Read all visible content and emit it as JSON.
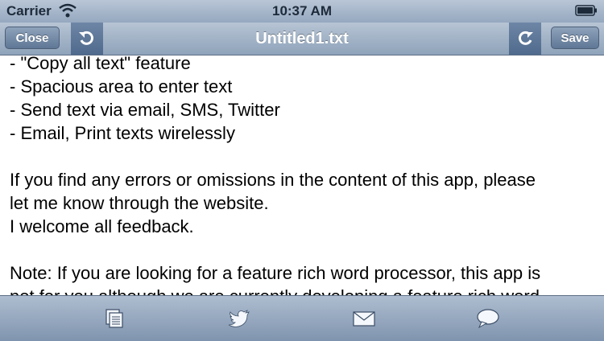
{
  "status": {
    "carrier": "Carrier",
    "time": "10:37 AM",
    "icons": [
      "wifi-icon",
      "battery-icon"
    ]
  },
  "nav": {
    "close_label": "Close",
    "title": "Untitled1.txt",
    "save_label": "Save",
    "icons": [
      "undo-icon",
      "redo-icon"
    ]
  },
  "editor": {
    "lines": [
      "- \"Copy all text\" feature",
      "- Spacious area to enter text",
      "- Send text via email, SMS, Twitter",
      "- Email, Print texts wirelessly",
      "",
      "If you find any errors or omissions in the content of this app, please",
      "let me know through the website.",
      "I welcome all feedback.",
      "",
      "Note: If you are looking for a feature rich word processor, this app is",
      "not for you although we are currently developing a feature rich word"
    ]
  },
  "toolbar": {
    "icons": [
      "copy-pages-icon",
      "twitter-icon",
      "mail-icon",
      "sms-bubble-icon"
    ]
  },
  "colors": {
    "bar_top": "#b7c4d4",
    "bar_bottom": "#8fa3ba",
    "button": "#5f7896",
    "text": "#000000"
  }
}
